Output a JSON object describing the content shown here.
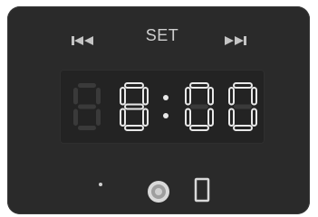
{
  "controls": {
    "prev_icon": "skip-previous-icon",
    "set_label": "SET",
    "next_icon": "skip-next-icon"
  },
  "display": {
    "time": "8:00",
    "digit_color": "#e8e8e8",
    "ghost_color": "#3a3a3a"
  },
  "bottom": {
    "indicator_icon": "dot-indicator-icon",
    "knob_icon": "knob-icon",
    "phone_icon": "phone-icon"
  }
}
